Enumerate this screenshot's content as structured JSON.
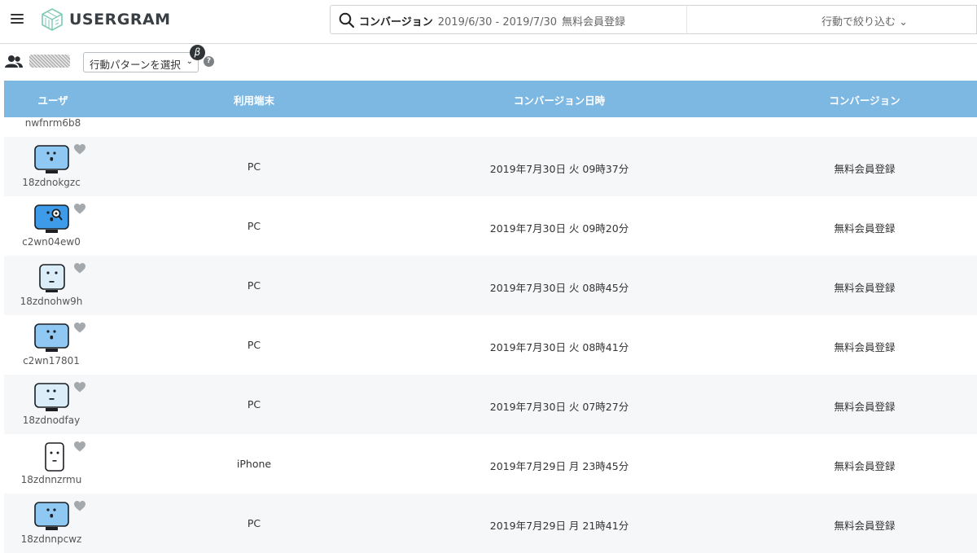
{
  "app": {
    "name": "USERGRAM"
  },
  "search": {
    "conversion_label": "コンバージョン",
    "date_range": "2019/6/30 - 2019/7/30",
    "goal": "無料会員登録"
  },
  "filter": {
    "label": "行動で絞り込む",
    "chevron": "⌄"
  },
  "subbar": {
    "pattern_select_label": "行動パターンを選択",
    "beta_label": "β",
    "help_label": "?"
  },
  "table": {
    "headers": [
      "ユーザ",
      "利用端末",
      "コンバージョン日時",
      "コンバージョン"
    ],
    "partial_row_user": "nwfnrm6b8",
    "rows": [
      {
        "user_id": "18zdnokgzc",
        "device": "PC",
        "datetime": "2019年7月30日 火 09時37分",
        "conversion": "無料会員登録",
        "avatar": "pc-face-blue"
      },
      {
        "user_id": "c2wn04ew0",
        "device": "PC",
        "datetime": "2019年7月30日 火 09時20分",
        "conversion": "無料会員登録",
        "avatar": "pc-face-magnifier"
      },
      {
        "user_id": "18zdnohw9h",
        "device": "PC",
        "datetime": "2019年7月30日 火 08時45分",
        "conversion": "無料会員登録",
        "avatar": "pc-face-light"
      },
      {
        "user_id": "c2wn17801",
        "device": "PC",
        "datetime": "2019年7月30日 火 08時41分",
        "conversion": "無料会員登録",
        "avatar": "pc-face-blue"
      },
      {
        "user_id": "18zdnodfay",
        "device": "PC",
        "datetime": "2019年7月30日 火 07時27分",
        "conversion": "無料会員登録",
        "avatar": "pc-face-light"
      },
      {
        "user_id": "18zdnnzrmu",
        "device": "iPhone",
        "datetime": "2019年7月29日 月 23時45分",
        "conversion": "無料会員登録",
        "avatar": "phone-face"
      },
      {
        "user_id": "18zdnnpcwz",
        "device": "PC",
        "datetime": "2019年7月29日 月 21時41分",
        "conversion": "無料会員登録",
        "avatar": "pc-face-blue"
      }
    ]
  },
  "colors": {
    "header_blue": "#7db8e3",
    "avatar_blue": "#8fc8f2",
    "avatar_deep_blue": "#3d9be9",
    "avatar_light": "#dcedfa",
    "heart_gray": "#a4a9ae"
  }
}
